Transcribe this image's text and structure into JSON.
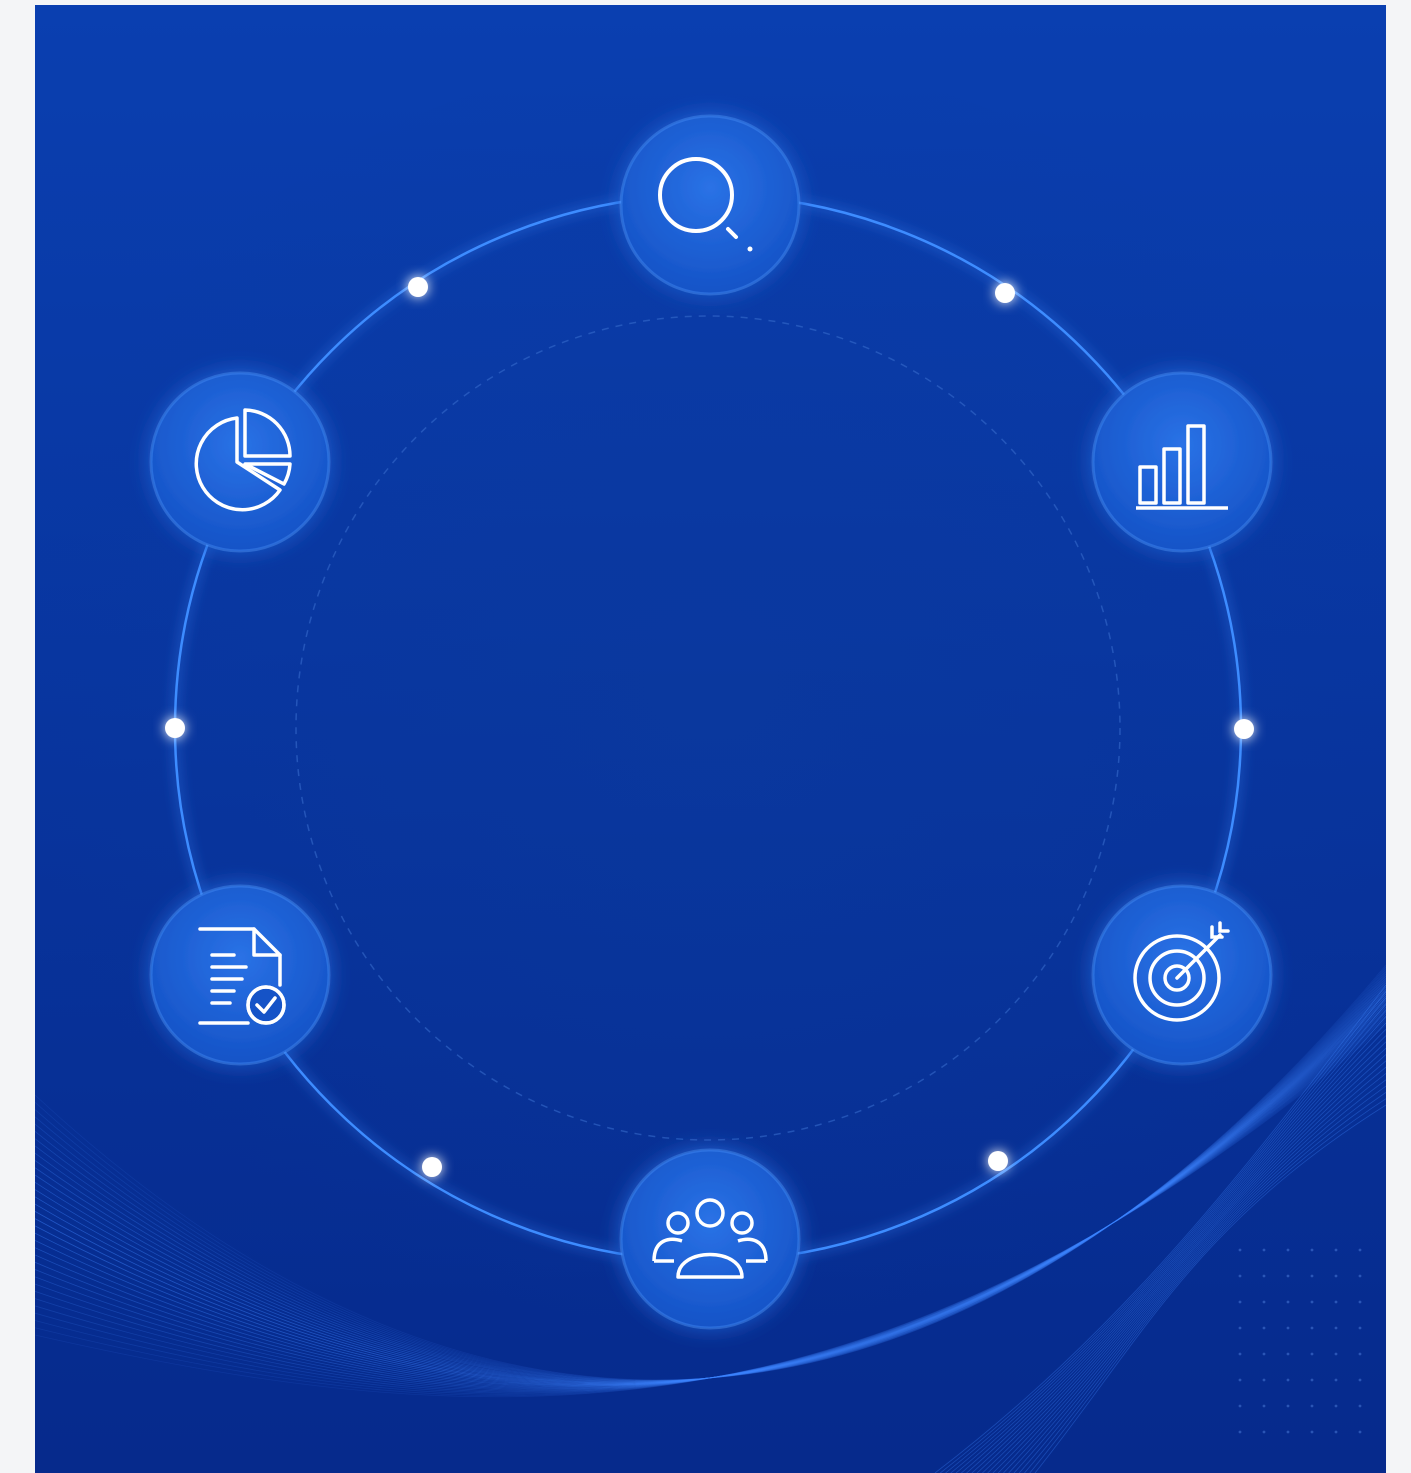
{
  "colors": {
    "page_background": "#f4f5f7",
    "panel_background_top": "#0a3fb0",
    "panel_background_bottom": "#062a8c",
    "ring": "#3d8cff",
    "node_fill": "#1a5fd6",
    "node_glow": "#4f9bff",
    "dot": "#ffffff",
    "icon_stroke": "#ffffff",
    "wave": "#3f86ff"
  },
  "nodes": [
    {
      "name": "search",
      "icon": "search-icon"
    },
    {
      "name": "bar-chart",
      "icon": "bar-chart-icon"
    },
    {
      "name": "target",
      "icon": "target-icon"
    },
    {
      "name": "team",
      "icon": "team-icon"
    },
    {
      "name": "document",
      "icon": "document-check-icon"
    },
    {
      "name": "pie-chart",
      "icon": "pie-chart-icon"
    }
  ],
  "connector_dots": 6
}
